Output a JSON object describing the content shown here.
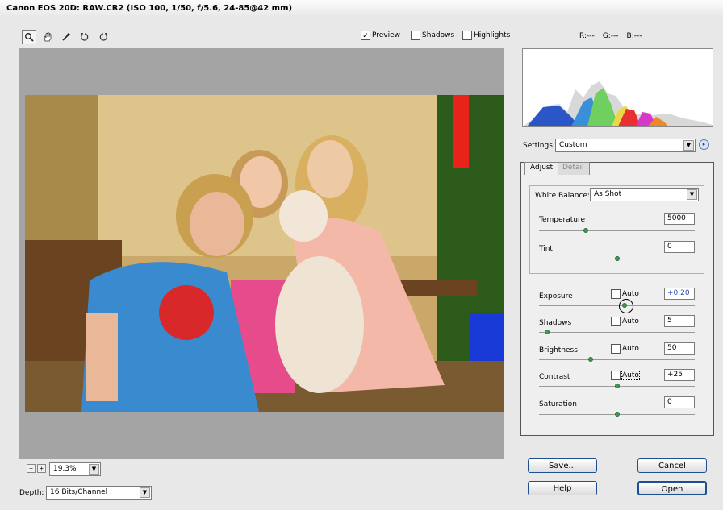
{
  "window": {
    "title": "Canon EOS 20D: RAW.CR2 (ISO 100, 1/50, f/5.6, 24-85@42 mm)"
  },
  "toolbar": {
    "tools": [
      "zoom-icon",
      "hand-icon",
      "eyedropper-icon",
      "rotate-left-icon",
      "rotate-right-icon"
    ],
    "preview_label": "Preview",
    "preview_checked": true,
    "shadows_label": "Shadows",
    "shadows_checked": false,
    "highlights_label": "Highlights",
    "highlights_checked": false
  },
  "readout": {
    "r": "R:---",
    "g": "G:---",
    "b": "B:---"
  },
  "settings": {
    "label": "Settings:",
    "value": "Custom"
  },
  "tabs": {
    "adjust": "Adjust",
    "detail": "Detail"
  },
  "white_balance": {
    "label": "White Balance:",
    "value": "As Shot"
  },
  "controls": {
    "temperature": {
      "label": "Temperature",
      "value": "5000",
      "level": 0.3
    },
    "tint": {
      "label": "Tint",
      "value": "0",
      "level": 0.5
    },
    "exposure": {
      "label": "Exposure",
      "auto_label": "Auto",
      "value": "+0.20",
      "level": 0.55
    },
    "shadows": {
      "label": "Shadows",
      "auto_label": "Auto",
      "value": "5",
      "level": 0.05
    },
    "brightness": {
      "label": "Brightness",
      "auto_label": "Auto",
      "value": "50",
      "level": 0.33
    },
    "contrast": {
      "label": "Contrast",
      "auto_label": "Auto",
      "value": "+25",
      "level": 0.5
    },
    "saturation": {
      "label": "Saturation",
      "value": "0",
      "level": 0.5
    }
  },
  "zoom": {
    "value": "19.3%"
  },
  "depth": {
    "label": "Depth:",
    "value": "16 Bits/Channel"
  },
  "buttons": {
    "save": "Save...",
    "cancel": "Cancel",
    "help": "Help",
    "open": "Open"
  },
  "colors": {
    "panel_border": "#555555",
    "slider_thumb": "#3f9a55",
    "button_border": "#1f4f8f"
  }
}
